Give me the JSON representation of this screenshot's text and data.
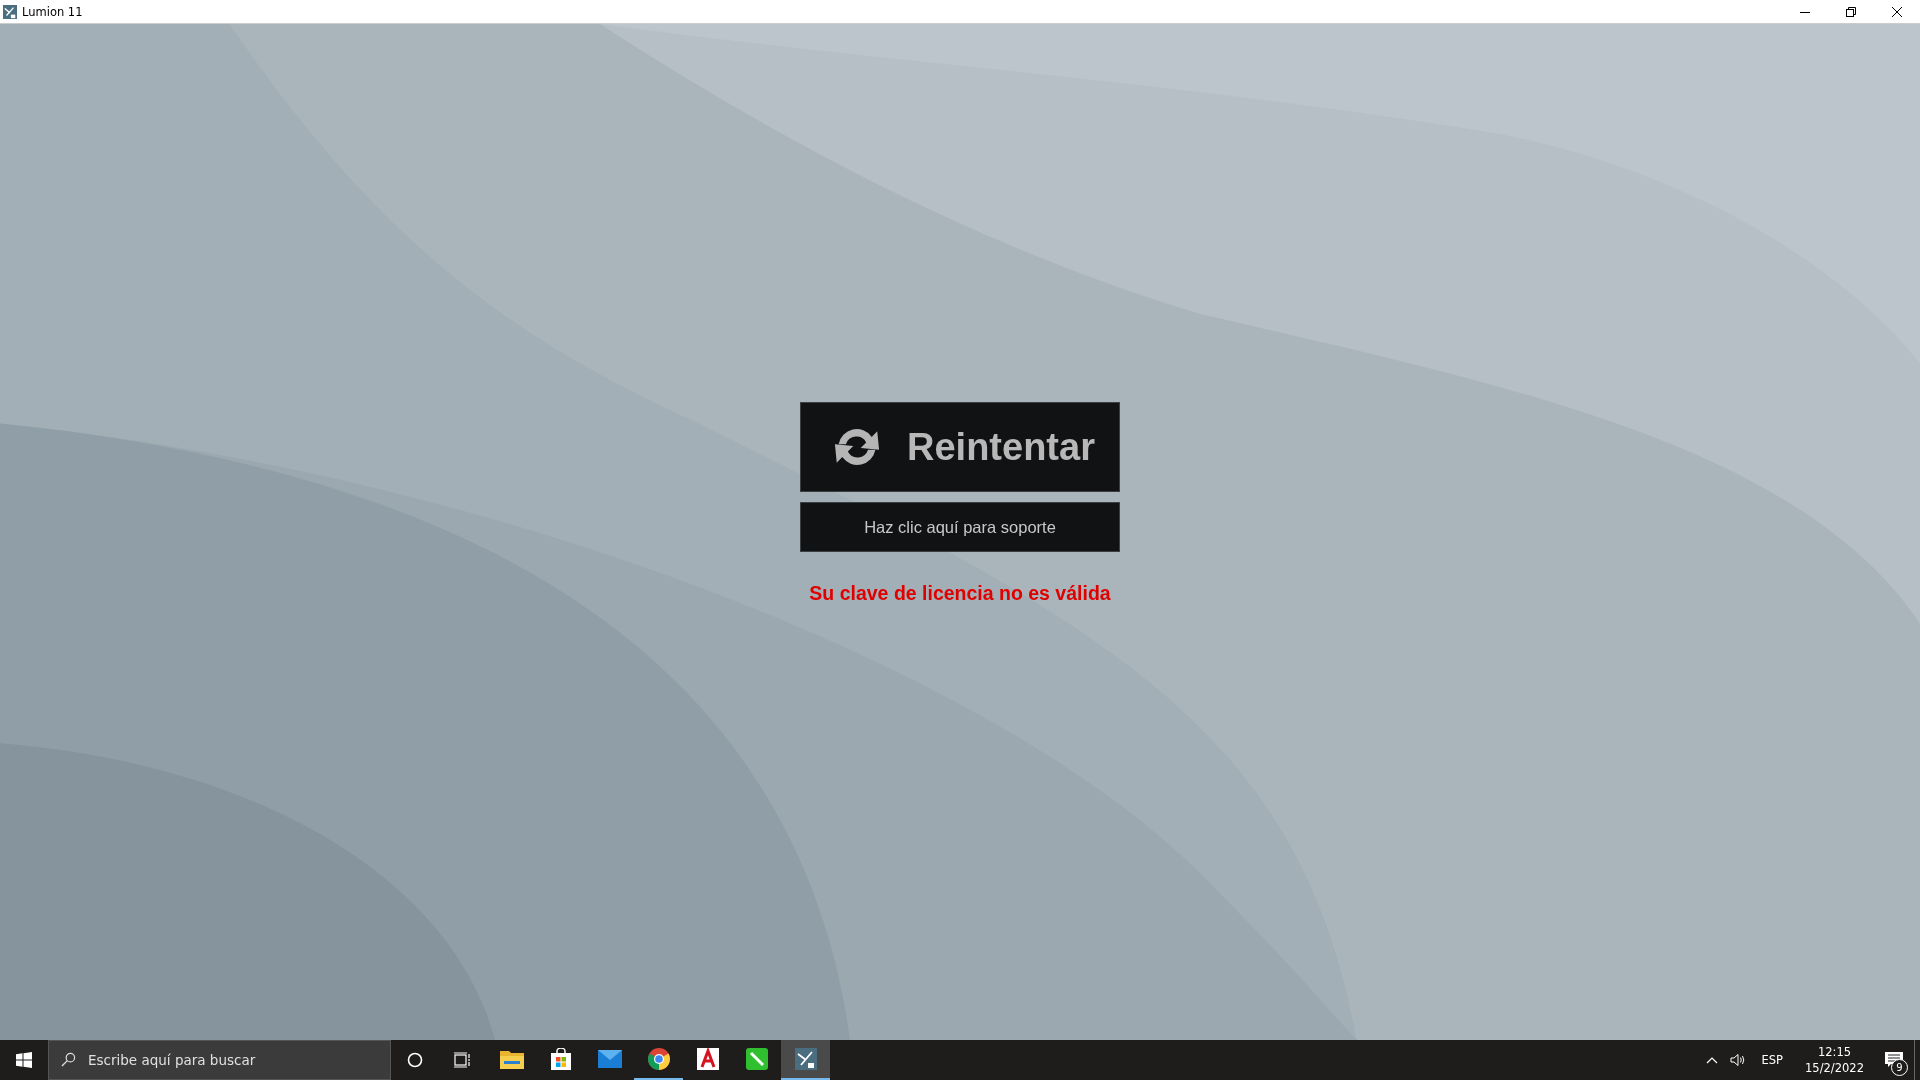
{
  "window": {
    "title": "Lumion 11"
  },
  "dialog": {
    "retry_button": "Reintentar",
    "support_button": "Haz clic aquí para soporte",
    "error_message": "Su clave de licencia no es válida"
  },
  "taskbar": {
    "search": {
      "placeholder": "Escribe aquí para buscar"
    },
    "apps": [
      {
        "kind": "explorer",
        "running": false,
        "selected": false
      },
      {
        "kind": "store",
        "running": false,
        "selected": false
      },
      {
        "kind": "mail",
        "running": false,
        "selected": false
      },
      {
        "kind": "chrome",
        "running": true,
        "selected": false
      },
      {
        "kind": "acrobat",
        "running": false,
        "selected": false
      },
      {
        "kind": "green",
        "running": false,
        "selected": false
      },
      {
        "kind": "lumion",
        "running": true,
        "selected": true
      }
    ],
    "language": "ESP",
    "time": "12:15",
    "date": "15/2/2022",
    "notifications": "9"
  }
}
